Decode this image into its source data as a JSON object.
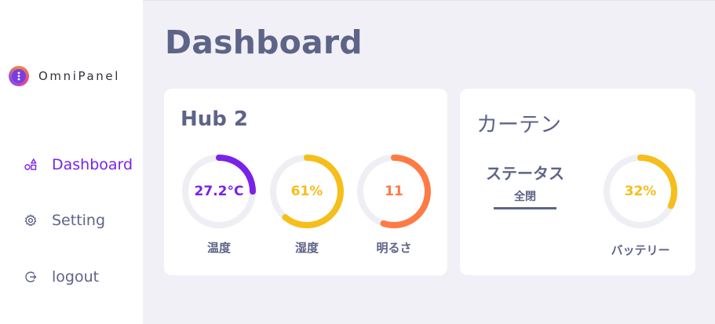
{
  "brand": {
    "name": "OmniPanel"
  },
  "nav": {
    "items": [
      {
        "label": "Dashboard",
        "icon": "shapes-icon",
        "active": true
      },
      {
        "label": "Setting",
        "icon": "gear-icon",
        "active": false
      },
      {
        "label": "logout",
        "icon": "logout-icon",
        "active": false
      }
    ]
  },
  "page": {
    "title": "Dashboard"
  },
  "hub": {
    "title": "Hub 2",
    "gauges": [
      {
        "value": "27.2°C",
        "label": "温度",
        "fraction": 0.25,
        "color": "#7a22e8"
      },
      {
        "value": "61%",
        "label": "湿度",
        "fraction": 0.61,
        "color": "#f5be1a"
      },
      {
        "value": "11",
        "label": "明るさ",
        "fraction": 0.55,
        "color": "#ff7a45"
      }
    ]
  },
  "curtain": {
    "title": "カーテン",
    "status_title": "ステータス",
    "status_value": "全閉",
    "battery": {
      "value": "32%",
      "label": "バッテリー",
      "fraction": 0.32,
      "color": "#f5be1a"
    }
  },
  "colors": {
    "accent": "#7a22e8",
    "text": "#5e6488",
    "track": "#eeeef5",
    "background": "#f0f0f6"
  }
}
